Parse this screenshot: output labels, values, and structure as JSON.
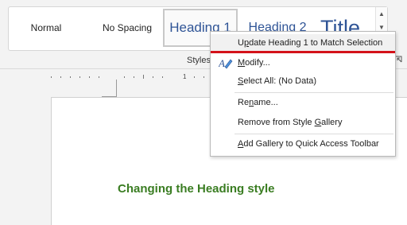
{
  "ribbon": {
    "styles": [
      {
        "label": "Normal"
      },
      {
        "label": "No Spacing"
      },
      {
        "label": "Heading 1"
      },
      {
        "label": "Heading 2"
      },
      {
        "label": "Title"
      }
    ],
    "group_label": "Styles"
  },
  "ruler": {
    "marks": [
      "1"
    ]
  },
  "document": {
    "heading": "Changing the Heading style"
  },
  "context_menu": {
    "items": [
      {
        "label": "Update Heading 1 to Match Selection",
        "hotkey_char": "p",
        "icon": "none"
      },
      {
        "label": "Modify...",
        "hotkey_char": "M",
        "icon": "edit-style-icon"
      },
      {
        "label": "Select All: (No Data)",
        "hotkey_char": "S",
        "icon": "none"
      },
      {
        "label": "Rename...",
        "hotkey_char": "n",
        "icon": "none"
      },
      {
        "label": "Remove from Style Gallery",
        "hotkey_char": "G",
        "icon": "none"
      },
      {
        "label": "Add Gallery to Quick Access Toolbar",
        "hotkey_char": "A",
        "icon": "none"
      }
    ],
    "highlight_color": "#d4121a"
  },
  "colors": {
    "heading_blue": "#2f5496",
    "doc_heading_green": "#3a7d22"
  }
}
